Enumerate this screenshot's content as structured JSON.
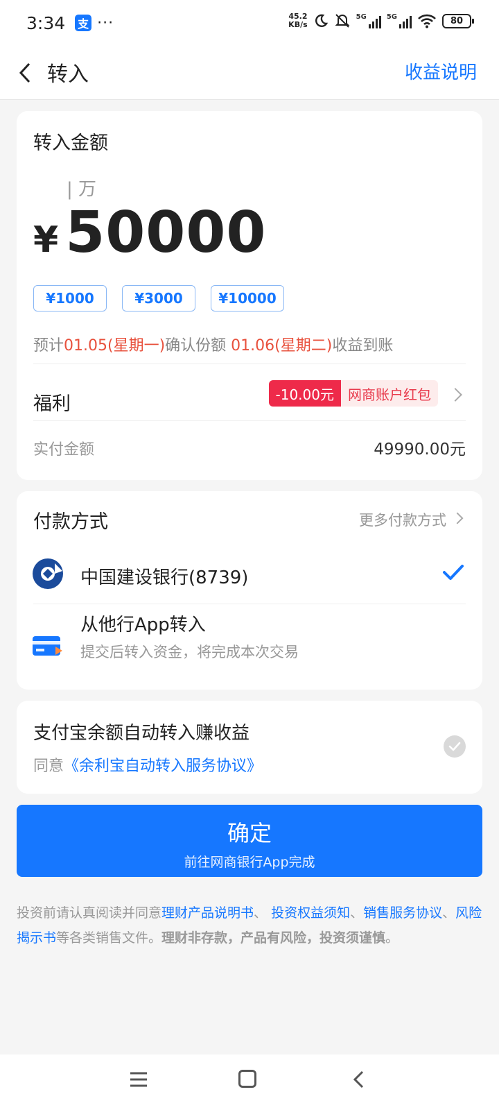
{
  "status": {
    "time": "3:34",
    "app_badge": "支",
    "dots": "···",
    "net_speed_value": "45.2",
    "net_speed_unit": "KB/s",
    "sim1": "5G",
    "sim2": "5G",
    "battery": "80"
  },
  "nav": {
    "title": "转入",
    "right_link": "收益说明"
  },
  "amount": {
    "label": "转入金额",
    "unit_hint": "| 万",
    "currency": "¥",
    "value": "50000",
    "quick_options": [
      "¥1000",
      "¥3000",
      "¥10000"
    ],
    "estimate": {
      "prefix": "预计",
      "confirm_date": "01.05(星期一)",
      "confirm_text": "确认份额 ",
      "income_date": "01.06(星期二)",
      "income_text": "收益到账"
    },
    "benefit_label": "福利",
    "benefit_amount": "-10.00元",
    "benefit_name": "网商账户红包",
    "paid_label": "实付金额",
    "paid_value": "49990.00元"
  },
  "payment": {
    "title": "付款方式",
    "more": "更多付款方式",
    "bank_name": "中国建设银行(8739)",
    "other_title": "从他行App转入",
    "other_sub": "提交后转入资金，将完成本次交易"
  },
  "auto": {
    "title": "支付宝余额自动转入赚收益",
    "agree_prefix": "同意",
    "agree_link": "《余利宝自动转入服务协议》"
  },
  "confirm": {
    "main": "确定",
    "sub": "前往网商银行App完成"
  },
  "disclaimer": {
    "t1": "投资前请认真阅读并同意",
    "l1": "理财产品说明书",
    "t2": "、 ",
    "l2": "投资权益须知",
    "t3": "、",
    "l3": "销售服务协议",
    "t4": "、",
    "l4": "风险揭示书",
    "t5": "等各类销售文件。",
    "b1": "理财非存款，产品有风险，投资须谨慎",
    "t6": "。"
  },
  "colors": {
    "accent": "#1677ff",
    "red": "#e8513d",
    "tag_red": "#ee2a4a"
  }
}
